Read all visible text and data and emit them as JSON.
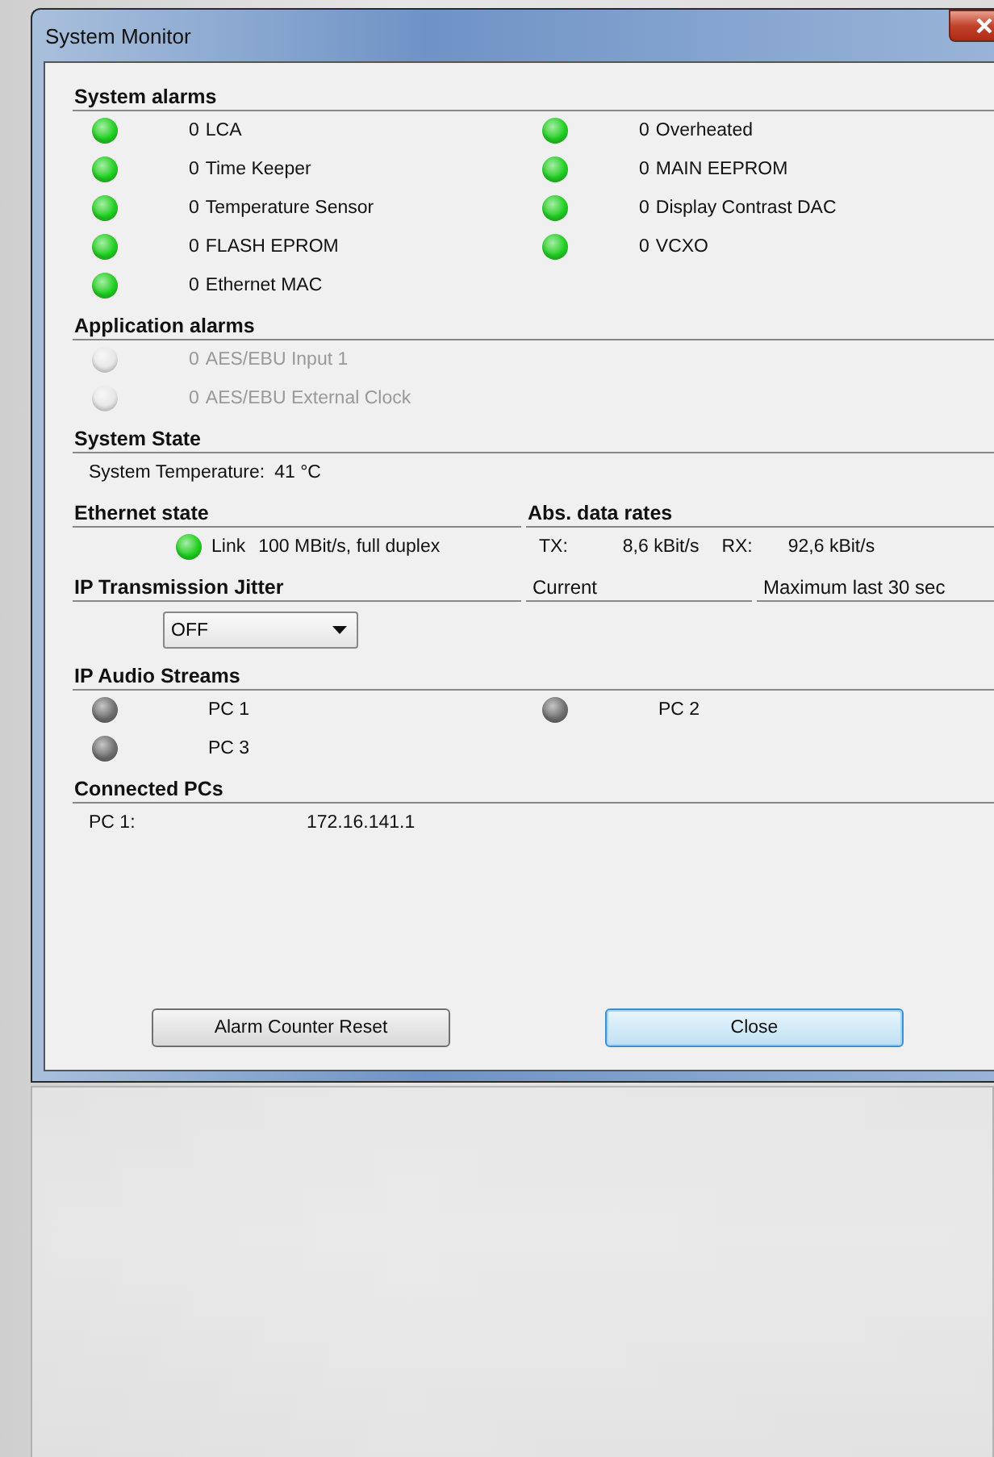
{
  "window": {
    "title": "System Monitor"
  },
  "system_alarms": {
    "title": "System alarms",
    "columns": [
      [
        {
          "count": "0",
          "label": "LCA",
          "color": "#22d022"
        },
        {
          "count": "0",
          "label": "Time Keeper",
          "color": "#22d022"
        },
        {
          "count": "0",
          "label": "Temperature Sensor",
          "color": "#22d022"
        },
        {
          "count": "0",
          "label": "FLASH EPROM",
          "color": "#22d022"
        },
        {
          "count": "0",
          "label": "Ethernet MAC",
          "color": "#22d022"
        }
      ],
      [
        {
          "count": "0",
          "label": "Overheated",
          "color": "#22d022"
        },
        {
          "count": "0",
          "label": "MAIN EEPROM",
          "color": "#22d022"
        },
        {
          "count": "0",
          "label": "Display Contrast DAC",
          "color": "#22d022"
        },
        {
          "count": "0",
          "label": "VCXO",
          "color": "#22d022"
        }
      ]
    ]
  },
  "application_alarms": {
    "title": "Application alarms",
    "items": [
      {
        "count": "0",
        "label": "AES/EBU Input 1",
        "color": "#e8e8e8",
        "disabled": true
      },
      {
        "count": "0",
        "label": "AES/EBU External Clock",
        "color": "#e8e8e8",
        "disabled": true
      }
    ]
  },
  "system_state": {
    "title": "System State",
    "label": "System Temperature:",
    "value": "41 °C"
  },
  "ethernet_state": {
    "title": "Ethernet state",
    "color": "#22d022",
    "label": "Link",
    "value": "100 MBit/s, full duplex"
  },
  "data_rates": {
    "title": "Abs. data rates",
    "tx_label": "TX:",
    "tx_value": "8,6 kBit/s",
    "rx_label": "RX:",
    "rx_value": "92,6 kBit/s"
  },
  "jitter": {
    "title": "IP Transmission Jitter",
    "current_label": "Current",
    "max_label": "Maximum last 30 sec",
    "dropdown": {
      "value": "OFF"
    }
  },
  "audio_streams": {
    "title": "IP Audio Streams",
    "columns": [
      [
        {
          "label": "PC 1",
          "color": "#707070"
        },
        {
          "label": "PC 3",
          "color": "#707070"
        }
      ],
      [
        {
          "label": "PC 2",
          "color": "#707070"
        }
      ]
    ]
  },
  "connected_pcs": {
    "title": "Connected PCs",
    "rows": [
      {
        "name": "PC 1:",
        "address": "172.16.141.1"
      }
    ]
  },
  "buttons": [
    {
      "label": "Alarm Counter Reset",
      "default": false
    },
    {
      "label": "Close",
      "default": true
    }
  ]
}
